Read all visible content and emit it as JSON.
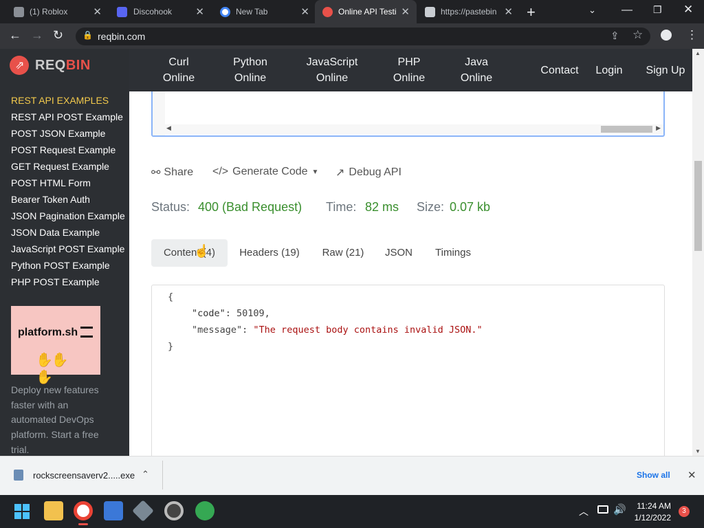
{
  "browser": {
    "tabs": [
      {
        "title": "(1) Roblox",
        "favicon": "roblox-icon"
      },
      {
        "title": "Discohook",
        "favicon": "discohook-icon"
      },
      {
        "title": "New Tab",
        "favicon": "chrome-icon"
      },
      {
        "title": "Online API Testi",
        "favicon": "reqbin-icon"
      },
      {
        "title": "https://pastebin",
        "favicon": "pastebin-icon"
      }
    ],
    "new_tab_glyph": "+",
    "url": "reqbin.com"
  },
  "site": {
    "logo_req": "REQ",
    "logo_bin": "BIN",
    "nav": [
      {
        "line1": "Curl",
        "line2": "Online"
      },
      {
        "line1": "Python",
        "line2": "Online"
      },
      {
        "line1": "JavaScript",
        "line2": "Online"
      },
      {
        "line1": "PHP",
        "line2": "Online"
      },
      {
        "line1": "Java",
        "line2": "Online"
      }
    ],
    "contact": "Contact",
    "login": "Login",
    "signup": "Sign Up"
  },
  "sidebar": {
    "heading": "REST API EXAMPLES",
    "items": [
      "REST API POST Example",
      "POST JSON Example",
      "POST Request Example",
      "GET Request Example",
      "POST HTML Form",
      "Bearer Token Auth",
      "JSON Pagination Example",
      "JSON Data Example",
      "JavaScript POST Example",
      "Python POST Example",
      "PHP POST Example"
    ],
    "ad_brand": "platform.sh",
    "ad_text": [
      "Deploy new features",
      "faster with an",
      "automated DevOps",
      "platform. Start a free",
      "trial."
    ]
  },
  "actions": {
    "share": "Share",
    "generate_code": "Generate Code",
    "debug_api": "Debug API"
  },
  "status": {
    "status_label": "Status:",
    "status_value": "400 (Bad Request)",
    "time_label": "Time:",
    "time_value": "82 ms",
    "size_label": "Size:",
    "size_value": "0.07 kb"
  },
  "response_tabs": [
    "Content (4)",
    "Headers (19)",
    "Raw (21)",
    "JSON",
    "Timings"
  ],
  "response_body": {
    "open": "{",
    "code_key": "\"code\"",
    "code_value": "50109,",
    "message_key": "\"message\"",
    "message_value": "\"The request body contains invalid JSON.\"",
    "close": "}"
  },
  "download": {
    "filename": "rockscreensaverv2.....exe",
    "show_all": "Show all"
  },
  "taskbar": {
    "time": "11:24 AM",
    "date": "1/12/2022",
    "notifications": "3"
  },
  "colors": {
    "accent_red": "#e8514a",
    "status_green": "#3a8f2e",
    "sidebar_heading": "#f2c94c",
    "link_blue": "#1a73e8"
  }
}
